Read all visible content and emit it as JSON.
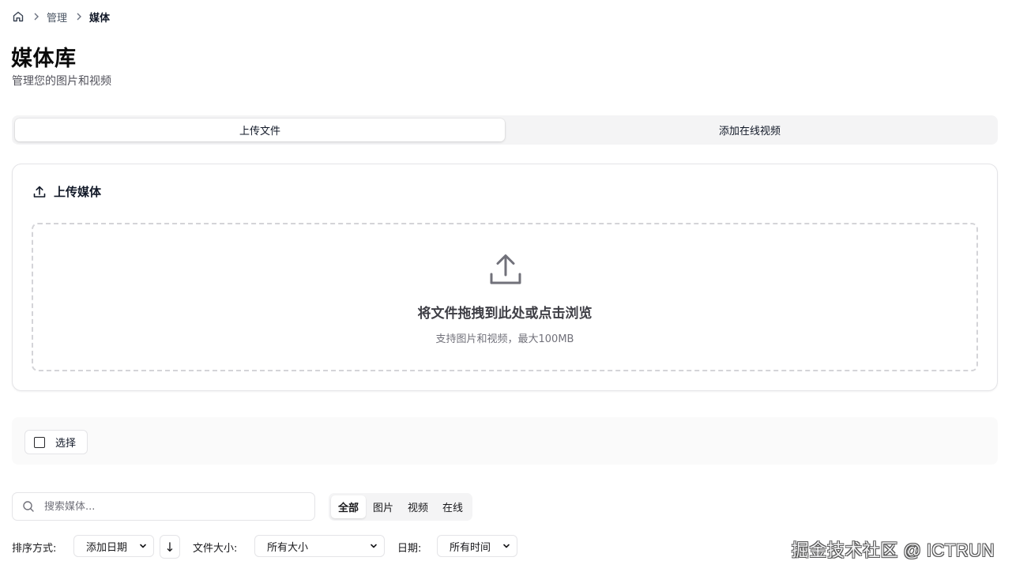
{
  "breadcrumb": {
    "items": [
      "管理",
      "媒体"
    ]
  },
  "header": {
    "title": "媒体库",
    "subtitle": "管理您的图片和视频"
  },
  "tabs": [
    {
      "label": "上传文件",
      "active": true
    },
    {
      "label": "添加在线视频",
      "active": false
    }
  ],
  "upload": {
    "title": "上传媒体",
    "drop_title": "将文件拖拽到此处或点击浏览",
    "drop_hint": "支持图片和视频，最大100MB"
  },
  "selection": {
    "select_label": "选择"
  },
  "search": {
    "placeholder": "搜索媒体..."
  },
  "type_filter": [
    {
      "label": "全部",
      "active": true
    },
    {
      "label": "图片",
      "active": false
    },
    {
      "label": "视频",
      "active": false
    },
    {
      "label": "在线",
      "active": false
    }
  ],
  "filters": {
    "sort_label": "排序方式:",
    "sort_value": "添加日期",
    "sort_direction": "↓",
    "size_label": "文件大小:",
    "size_value": "所有大小",
    "date_label": "日期:",
    "date_value": "所有时间"
  },
  "watermark": "掘金技术社区 @ ICTRUN",
  "colors": {
    "accent": "#111827",
    "muted": "#71717a",
    "border": "#e4e4e7"
  }
}
